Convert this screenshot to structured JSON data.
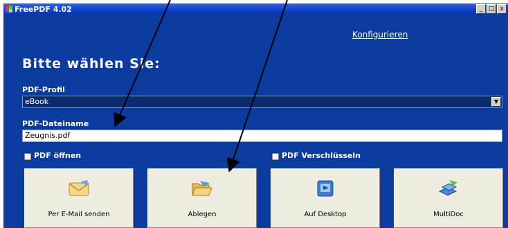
{
  "window": {
    "title": "FreePDF 4.02"
  },
  "links": {
    "konfigurieren": "Konfigurieren"
  },
  "heading": "Bitte wählen Sie:",
  "profile": {
    "label": "PDF-Profil",
    "selected": "eBook"
  },
  "filename": {
    "label": "PDF-Dateiname",
    "value": "Zeugnis.pdf"
  },
  "options": {
    "open_pdf": "PDF öffnen",
    "encrypt_pdf": "PDF Verschlüsseln"
  },
  "buttons": [
    {
      "label": "Per E-Mail senden",
      "icon": "envelope-icon"
    },
    {
      "label": "Ablegen",
      "icon": "open-folder-icon"
    },
    {
      "label": "Auf Desktop",
      "icon": "desktop-icon"
    },
    {
      "label": "MultiDoc",
      "icon": "multidoc-icon"
    }
  ],
  "colors": {
    "window_bg": "#0c3ba0",
    "titlebar": "#0d3ec3",
    "button_bg": "#efeddf"
  }
}
